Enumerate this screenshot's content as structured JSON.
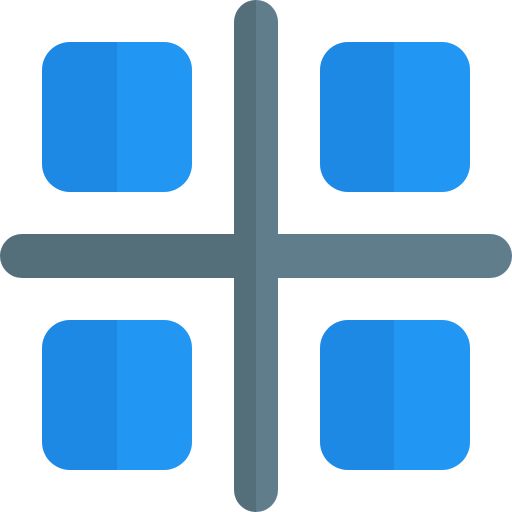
{
  "icon": {
    "name": "grid-separator-icon",
    "colors": {
      "tile_light": "#2196F3",
      "tile_dark": "#1E88E5",
      "line_dark": "#546E7A",
      "line_light": "#607D8B"
    },
    "tiles": [
      "top-left",
      "top-right",
      "bottom-left",
      "bottom-right"
    ]
  }
}
